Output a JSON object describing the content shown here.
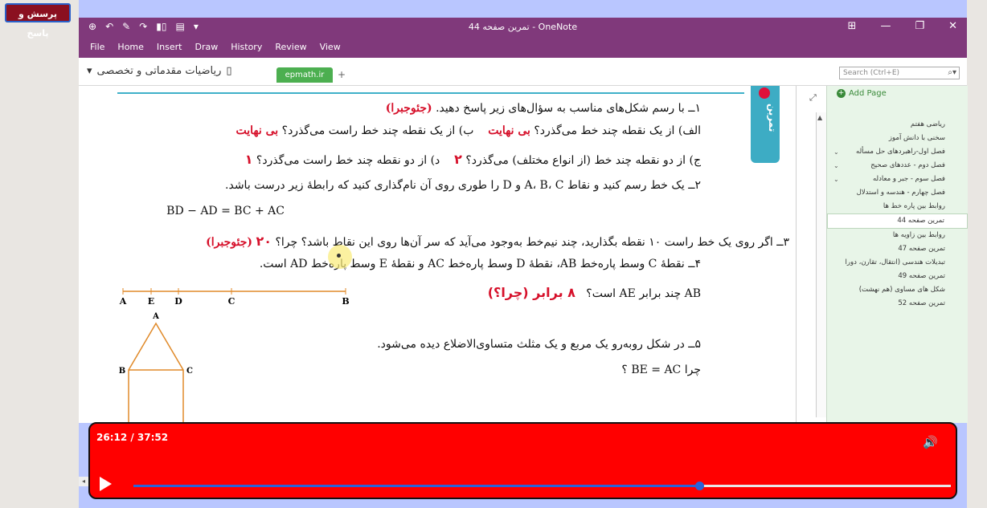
{
  "overlay": {
    "qa_button": "پرسش و پاسخ"
  },
  "titlebar": {
    "title": "تمرین صفحه 44 - OneNote",
    "qat_icons": [
      "back-icon",
      "forward-icon",
      "pen-icon",
      "redo-icon",
      "dock-icon",
      "view-icon",
      "dropdown-icon"
    ],
    "window_controls": [
      "restore-ribbon-icon",
      "minimize-icon",
      "maximize-icon",
      "close-icon"
    ]
  },
  "menu": {
    "items": [
      "File",
      "Home",
      "Insert",
      "Draw",
      "History",
      "Review",
      "View"
    ]
  },
  "notebook": {
    "title": "ریاضیات مقدماتی و تخصصی",
    "active_section": "epmath.ir",
    "add_tab": "+"
  },
  "search": {
    "placeholder": "Search (Ctrl+E)"
  },
  "note": {
    "tag": "تمرین",
    "q1": "۱ــ با رسم شکل‌های مناسب به سؤال‌های زیر پاسخ دهید.",
    "q1_note": "(جئوجبرا)",
    "q1a": "الف) از یک نقطه چند خط می‌گذرد؟",
    "q1a_ans": "بی نهایت",
    "q1b": "ب) از یک نقطه چند خط راست می‌گذرد؟",
    "q1b_ans": "بی نهایت",
    "q1c": "ج) از دو نقطه چند خط (از انواع مختلف) می‌گذرد؟",
    "q1c_ans": "۲",
    "q1d": "د) از دو نقطه چند خط راست می‌گذرد؟",
    "q1d_ans": "۱",
    "q2": "۲ــ یک خط رسم کنید و نقاط A، B، C و D را طوری روی آن نام‌گذاری کنید که رابطهٔ زیر درست باشد.",
    "q2_formula": "BD − AD = BC + AC",
    "q3": "۳ــ اگر روی یک خط راست ۱۰ نقطه بگذارید، چند نیم‌خط به‌وجود می‌آید که سر آن‌ها روی این نقاط باشد؟ چرا؟",
    "q3_ans": "۲۰",
    "q3_note": "(جئوجبرا)",
    "q4": "۴ــ نقطهٔ C وسط پاره‌خط AB، نقطهٔ D وسط پاره‌خط AC و نقطهٔ E وسط پاره‌خط AD است.",
    "q4b_prefix": "AB",
    "q4b": "چند برابر",
    "q4b_mid": "AE",
    "q4b_end": "است؟",
    "q4_ans": "۸ برابر (چرا؟)",
    "segment_labels": [
      "A",
      "E",
      "D",
      "C",
      "B"
    ],
    "q5": "۵ــ در شکل روبه‌رو یک مربع و یک مثلث متساوی‌الاضلاع دیده می‌شود.",
    "q5b": "چرا BE = AC ؟",
    "figure_labels": {
      "apex": "A",
      "left": "B",
      "right": "C"
    }
  },
  "pages_panel": {
    "add_page": "Add Page",
    "pages": [
      {
        "label": "ریاضی هفتم",
        "chevron": false,
        "selected": false
      },
      {
        "label": "سخنی با دانش آموز",
        "chevron": false,
        "selected": false
      },
      {
        "label": "فصل اول-راهبردهای حل مسأله",
        "chevron": true,
        "selected": false
      },
      {
        "label": "فصل دوم - عددهای صحیح",
        "chevron": true,
        "selected": false
      },
      {
        "label": "فصل سوم - جبر و معادله",
        "chevron": true,
        "selected": false
      },
      {
        "label": "فصل چهارم - هندسه و استدلال",
        "chevron": false,
        "selected": false
      },
      {
        "label": "روابط بین پاره خط ها",
        "chevron": false,
        "selected": false
      },
      {
        "label": "تمرین صفحه 44",
        "chevron": false,
        "selected": true
      },
      {
        "label": "روابط بین زاویه ها",
        "chevron": false,
        "selected": false
      },
      {
        "label": "تمرین صفحه 47",
        "chevron": false,
        "selected": false
      },
      {
        "label": "تبدیلات هندسی (انتقال، تقارن، دورا",
        "chevron": false,
        "selected": false
      },
      {
        "label": "تمرین صفحه 49",
        "chevron": false,
        "selected": false
      },
      {
        "label": "شکل های مساوی (هم نهشت)",
        "chevron": false,
        "selected": false
      },
      {
        "label": "تمرین صفحه 52",
        "chevron": false,
        "selected": false
      }
    ]
  },
  "player": {
    "time": "26:12 / 37:52",
    "progress": 0.692,
    "colors": {
      "background": "#ff0000",
      "progress": "#2a64d8"
    }
  }
}
